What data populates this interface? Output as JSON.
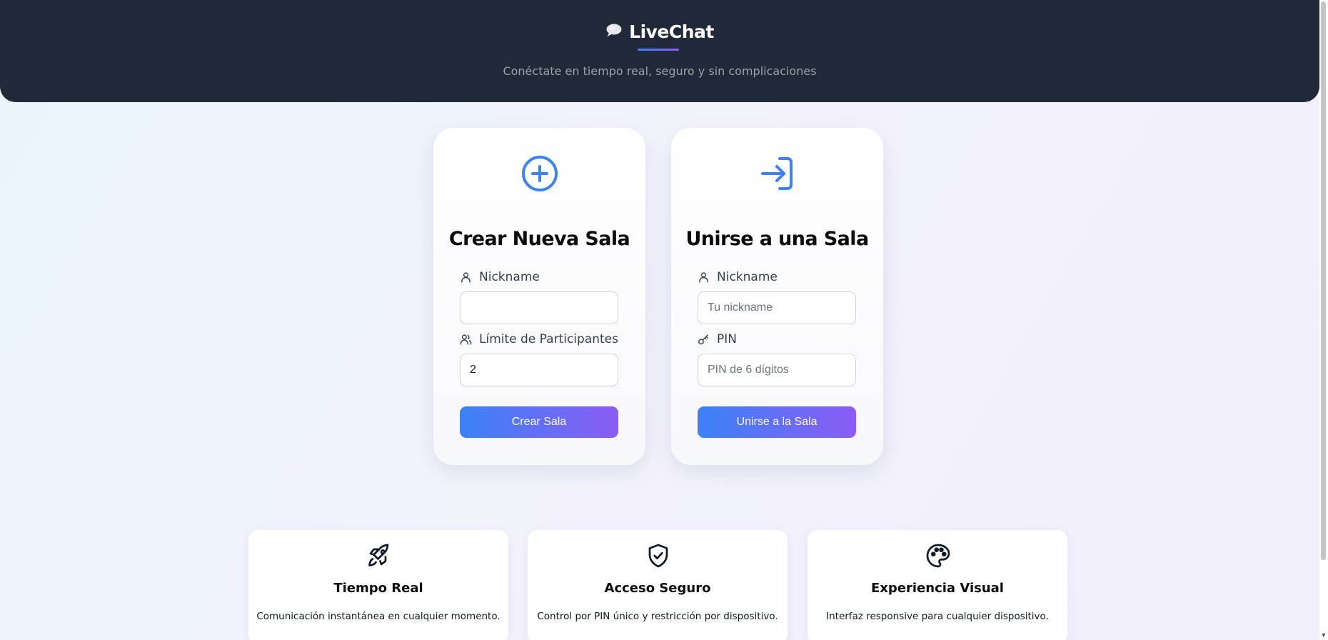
{
  "header": {
    "logo_icon": "speech-bubble-icon",
    "title": "LiveChat",
    "subtitle": "Conéctate en tiempo real, seguro y sin complicaciones"
  },
  "create_card": {
    "icon": "plus-circle-icon",
    "title": "Crear Nueva Sala",
    "nickname_label": "Nickname",
    "nickname_value": "",
    "nickname_placeholder": "",
    "limit_label": "Límite de Participantes",
    "limit_value": "2",
    "button_label": "Crear Sala"
  },
  "join_card": {
    "icon": "login-icon",
    "title": "Unirse a una Sala",
    "nickname_label": "Nickname",
    "nickname_placeholder": "Tu nickname",
    "pin_label": "PIN",
    "pin_placeholder": "PIN de 6 dígitos",
    "button_label": "Unirse a la Sala"
  },
  "features": [
    {
      "icon": "rocket-icon",
      "title": "Tiempo Real",
      "description": "Comunicación instantánea en cualquier momento."
    },
    {
      "icon": "shield-check-icon",
      "title": "Acceso Seguro",
      "description": "Control por PIN único y restricción por dispositivo."
    },
    {
      "icon": "palette-icon",
      "title": "Experiencia Visual",
      "description": "Interfaz responsive para cualquier dispositivo."
    }
  ],
  "colors": {
    "header_bg": "#1f2937",
    "accent_blue": "#3b82f6",
    "accent_purple": "#8b5cf6"
  }
}
